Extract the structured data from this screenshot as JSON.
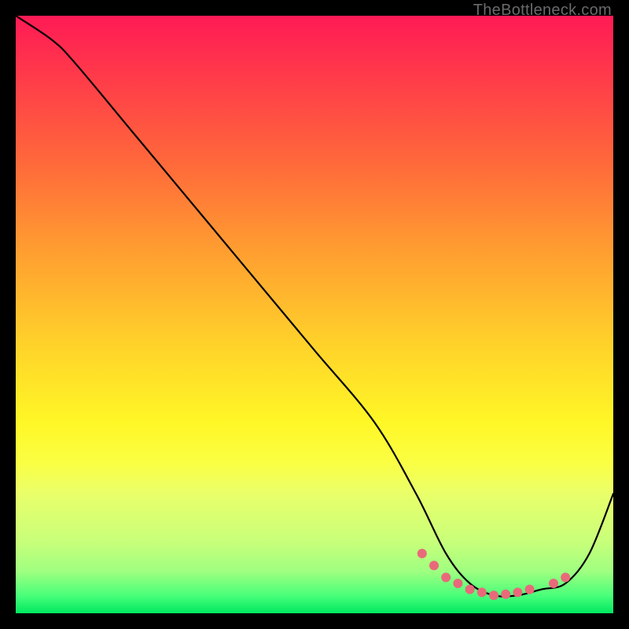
{
  "watermark": "TheBottleneck.com",
  "chart_data": {
    "type": "line",
    "title": "",
    "xlabel": "",
    "ylabel": "",
    "xlim": [
      0,
      100
    ],
    "ylim": [
      0,
      100
    ],
    "series": [
      {
        "name": "bottleneck-curve",
        "x": [
          0,
          6,
          10,
          20,
          30,
          40,
          50,
          60,
          67,
          72,
          76,
          80,
          84,
          88,
          92,
          96,
          100
        ],
        "values": [
          100,
          96,
          92,
          80,
          68,
          56,
          44,
          32,
          20,
          10,
          5,
          3,
          3,
          4,
          5,
          10,
          20
        ]
      }
    ],
    "markers": {
      "name": "highlight-dots",
      "x": [
        68,
        70,
        72,
        74,
        76,
        78,
        80,
        82,
        84,
        86,
        90,
        92
      ],
      "values": [
        10,
        8,
        6,
        5,
        4,
        3.5,
        3,
        3.2,
        3.5,
        4,
        5,
        6
      ]
    },
    "marker_color": "#e86a7a",
    "curve_color": "#000000"
  }
}
